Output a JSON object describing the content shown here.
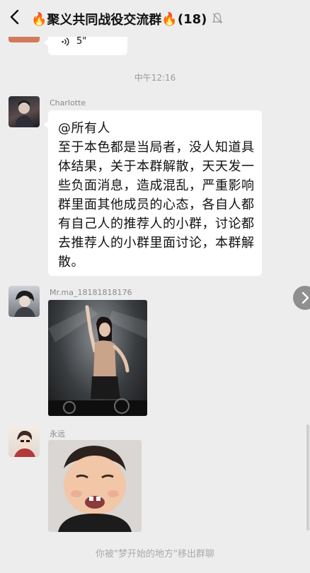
{
  "header": {
    "title": "聚义共同战役交流群",
    "flame_left": "🔥",
    "flame_right": "🔥",
    "member_count": "(18)"
  },
  "voice_message": {
    "duration": "5\""
  },
  "time_divider": "中午12:16",
  "messages": [
    {
      "sender": "Charlotte",
      "text": "@所有人\n至于本色都是当局者，没人知道具体结果，关于本群解散，天天发一些负面消息，造成混乱，严重影响群里面其他成员的心态，各自人都有自己人的推荐人的小群，讨论都去推荐人的小群里面讨论，本群解散。"
    },
    {
      "sender": "Mr.ma_18181818176"
    },
    {
      "sender": "永远"
    }
  ],
  "system_notice": "你被\"梦开始的地方\"移出群聊",
  "colors": {
    "background": "#ededed",
    "bubble": "#ffffff",
    "meta_text": "#888888"
  }
}
